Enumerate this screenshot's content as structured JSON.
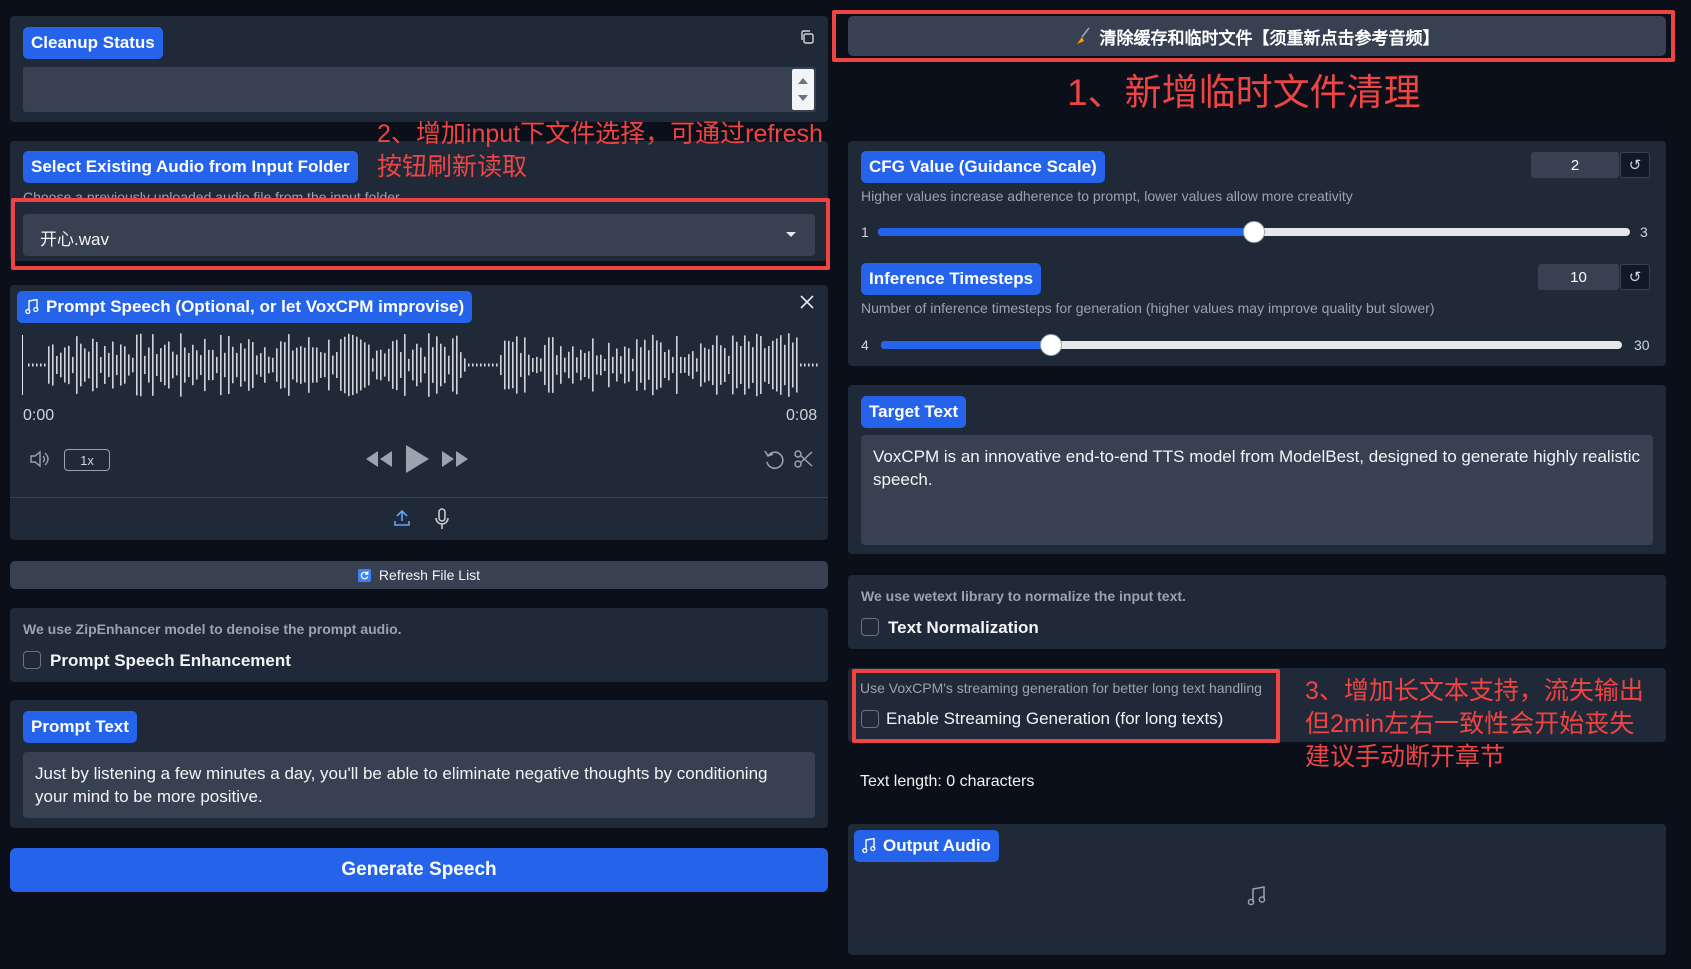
{
  "cleanup": {
    "status_label": "Cleanup Status",
    "status_value": "",
    "button_label": "清除缓存和临时文件【须重新点击参考音频】"
  },
  "annotations": {
    "note1": "1、新增临时文件清理",
    "note2_line1": "2、增加input下文件选择，可通过refresh",
    "note2_line2": "按钮刷新读取",
    "note3_line1": "3、增加长文本支持，流失输出",
    "note3_line2": "但2min左右一致性会开始丧失",
    "note3_line3": "建议手动断开章节"
  },
  "select_audio": {
    "label": "Select Existing Audio from Input Folder",
    "info": "Choose a previously uploaded audio file from the input folder",
    "value": "开心.wav"
  },
  "prompt_speech": {
    "label": "Prompt Speech (Optional, or let VoxCPM improvise)",
    "time_current": "0:00",
    "time_total": "0:08",
    "playback_rate": "1x"
  },
  "refresh_button": "Refresh File List",
  "enhancement": {
    "info": "We use ZipEnhancer model to denoise the prompt audio.",
    "label": "Prompt Speech Enhancement",
    "checked": false
  },
  "prompt_text": {
    "label": "Prompt Text",
    "value": "Just by listening a few minutes a day, you'll be able to eliminate negative thoughts by conditioning your mind to be more positive."
  },
  "generate_button": "Generate Speech",
  "cfg": {
    "label": "CFG Value (Guidance Scale)",
    "info": "Higher values increase adherence to prompt, lower values allow more creativity",
    "value": "2",
    "min": "1",
    "max": "3",
    "fraction": 0.5
  },
  "timesteps": {
    "label": "Inference Timesteps",
    "info": "Number of inference timesteps for generation (higher values may improve quality but slower)",
    "value": "10",
    "min": "4",
    "max": "30",
    "fraction": 0.23
  },
  "target_text": {
    "label": "Target Text",
    "value": "VoxCPM is an innovative end-to-end TTS model from ModelBest, designed to generate highly realistic speech."
  },
  "normalization": {
    "info": "We use wetext library to normalize the input text.",
    "label": "Text Normalization",
    "checked": false
  },
  "streaming": {
    "info": "Use VoxCPM's streaming generation for better long text handling",
    "label": "Enable Streaming Generation (for long texts)",
    "checked": false
  },
  "text_length": "Text length: 0 characters",
  "output_audio": {
    "label": "Output Audio"
  },
  "icons": {
    "copy": "copy-icon",
    "broom": "broom-icon",
    "music": "music-note-icon",
    "close": "close-icon",
    "volume": "volume-icon",
    "rewind": "rewind-icon",
    "play": "play-icon",
    "forward": "fast-forward-icon",
    "undo": "undo-icon",
    "trim": "scissors-icon",
    "upload": "upload-icon",
    "mic": "microphone-icon",
    "refresh": "refresh-icon"
  },
  "colors": {
    "accent": "#2563eb",
    "annotation": "#ef4444",
    "background": "#0b0f19",
    "panel": "#1f2937"
  }
}
